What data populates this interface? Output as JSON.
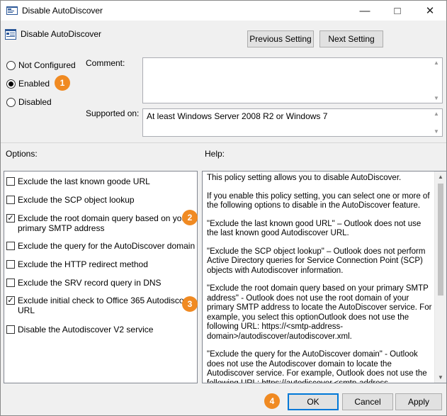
{
  "window": {
    "title": "Disable AutoDiscover"
  },
  "header": {
    "title": "Disable AutoDiscover"
  },
  "nav": {
    "previous_label": "Previous Setting",
    "next_label": "Next Setting"
  },
  "state": {
    "options": [
      {
        "label": "Not Configured",
        "checked": false
      },
      {
        "label": "Enabled",
        "checked": true
      },
      {
        "label": "Disabled",
        "checked": false
      }
    ]
  },
  "comment": {
    "label": "Comment:",
    "value": ""
  },
  "supported": {
    "label": "Supported on:",
    "value": "At least Windows Server 2008 R2 or Windows 7"
  },
  "options_label": "Options:",
  "help_label": "Help:",
  "options": [
    {
      "label": "Exclude the last known goode URL",
      "checked": false
    },
    {
      "label": "Exclude the SCP object lookup",
      "checked": false
    },
    {
      "label": "Exclude the root domain query based on your primary SMTP address",
      "checked": true
    },
    {
      "label": "Exclude the query for the AutoDiscover domain",
      "checked": false
    },
    {
      "label": "Exclude the HTTP redirect method",
      "checked": false
    },
    {
      "label": "Exclude the SRV record query in DNS",
      "checked": false
    },
    {
      "label": "Exclude initial check to Office 365 Autodiscover URL",
      "checked": true
    },
    {
      "label": "Disable the Autodiscover V2 service",
      "checked": false
    }
  ],
  "help_paragraphs": [
    "This policy setting allows you to disable AutoDiscover.",
    "If you enable this policy setting, you can select one or more of the following options to disable in the AutoDiscover feature.",
    "\"Exclude the last known good URL\" – Outlook does not use the last known good Autodiscover URL.",
    "\"Exclude the SCP object lookup\" – Outlook does not perform Active Directory queries for Service Connection Point (SCP) objects with Autodiscover information.",
    "\"Exclude the root domain query based on your primary SMTP address\" - Outlook does not use the root domain of your primary SMTP address to locate the AutoDiscover service. For example, you select this optionOutlook does not use the following URL: https://<smtp-address-domain>/autodiscover/autodiscover.xml.",
    "\"Exclude the query for the AutoDiscover domain\" - Outlook does not use the Autodiscover domain to locate the Autodiscover service. For example, Outlook does not use the following URL: https://autodiscover.<smtp-address-domain>/autodiscover/autodiscover.xml"
  ],
  "footer": {
    "ok_label": "OK",
    "cancel_label": "Cancel",
    "apply_label": "Apply"
  },
  "badges": [
    "1",
    "2",
    "3",
    "4"
  ],
  "colors": {
    "badge": "#f08a22",
    "focus_border": "#0078d7"
  }
}
